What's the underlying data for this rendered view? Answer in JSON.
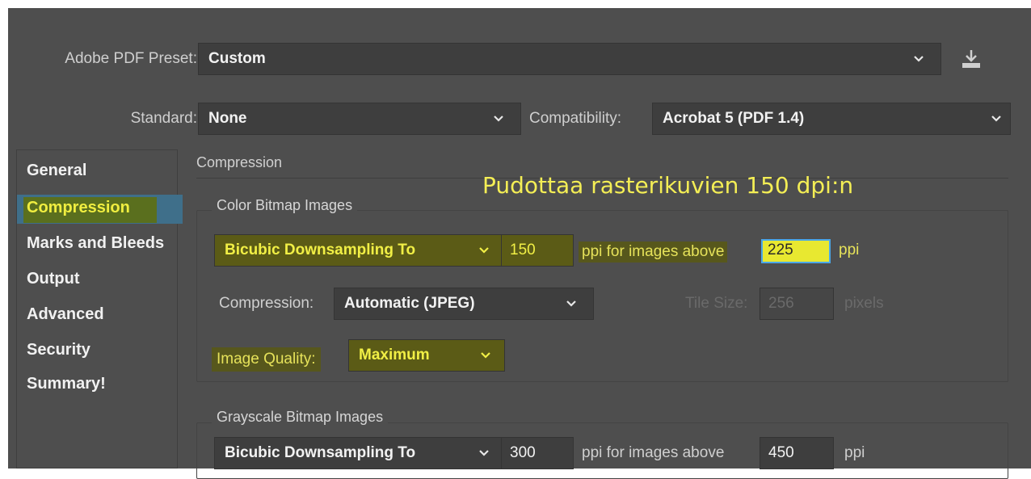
{
  "preset": {
    "label": "Adobe PDF Preset:",
    "value": "Custom"
  },
  "standard": {
    "label": "Standard:",
    "value": "None"
  },
  "compatibility": {
    "label": "Compatibility:",
    "value": "Acrobat 5 (PDF 1.4)"
  },
  "nav": {
    "items": [
      "General",
      "Compression",
      "Marks and Bleeds",
      "Output",
      "Advanced",
      "Security",
      "Summary!"
    ],
    "selected": "Compression"
  },
  "section": {
    "title": "Compression"
  },
  "annotation": "Pudottaa rasterikuvien 150 dpi:n",
  "color": {
    "title": "Color Bitmap Images",
    "sampling": "Bicubic Downsampling To",
    "ppi": "150",
    "above_label": "ppi for images above",
    "above": "225",
    "ppi_unit": "ppi",
    "compression_label": "Compression:",
    "compression": "Automatic (JPEG)",
    "tile_label": "Tile Size:",
    "tile": "256",
    "tile_unit": "pixels",
    "quality_label": "Image Quality:",
    "quality": "Maximum"
  },
  "gray": {
    "title": "Grayscale Bitmap Images",
    "sampling": "Bicubic Downsampling To",
    "ppi": "300",
    "above_label": "ppi for images above",
    "above": "450",
    "ppi_unit": "ppi"
  },
  "colors": {
    "dialog_bg": "#4e4e4e",
    "field_bg": "#3e3e3e",
    "highlight": "#d6d600",
    "annotation": "#f4ee55",
    "selection": "#3f6f8a"
  }
}
